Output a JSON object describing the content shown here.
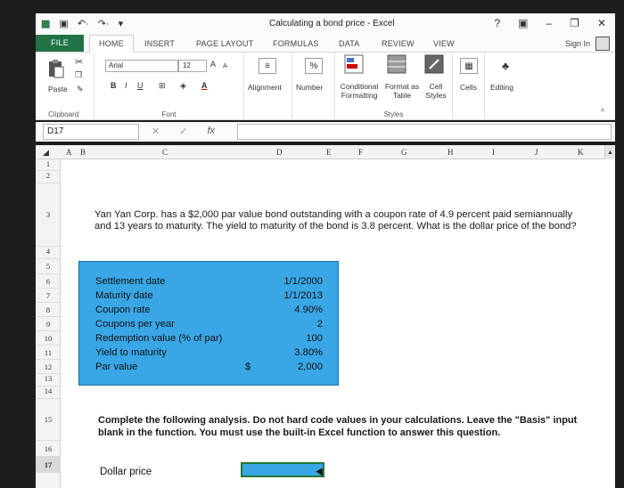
{
  "window": {
    "title": "Calculating a bond price - Excel",
    "help": "?",
    "minimize": "–",
    "close": "✕"
  },
  "tabs": {
    "file": "FILE",
    "items": [
      "HOME",
      "INSERT",
      "PAGE LAYOUT",
      "FORMULAS",
      "DATA",
      "REVIEW",
      "VIEW"
    ],
    "sign_in": "Sign In"
  },
  "ribbon": {
    "paste": "Paste",
    "clipboard": "Clipboard",
    "font_name": "Arial",
    "font_size": "12",
    "font_group": "Font",
    "alignment": "Alignment",
    "number": "Number",
    "conditional_formatting": "Conditional Formatting",
    "format_as_table": "Format as Table",
    "cell_styles": "Cell Styles",
    "styles_group": "Styles",
    "cells": "Cells",
    "editing": "Editing"
  },
  "formula_bar": {
    "name_box": "D17",
    "fx": "fx"
  },
  "sheet": {
    "columns": [
      "A",
      "B",
      "C",
      "D",
      "E",
      "F",
      "G",
      "H",
      "I",
      "J",
      "K"
    ],
    "rows": [
      "1",
      "2",
      "3",
      "4",
      "5",
      "6",
      "7",
      "8",
      "9",
      "10",
      "11",
      "12",
      "13",
      "14",
      "15",
      "16",
      "17"
    ],
    "selected_row": "17",
    "question": "Yan Yan Corp. has a $2,000 par value bond outstanding with a coupon rate of 4.9 percent paid semiannually and 13 years to maturity. The yield to maturity of the bond is 3.8 percent. What is the dollar price of the bond?",
    "inputs": [
      {
        "label": "Settlement date",
        "value": "1/1/2000"
      },
      {
        "label": "Maturity date",
        "value": "1/1/2013"
      },
      {
        "label": "Coupon rate",
        "value": "4.90%"
      },
      {
        "label": "Coupons per year",
        "value": "2"
      },
      {
        "label": "Redemption value (% of par)",
        "value": "100"
      },
      {
        "label": "Yield to maturity",
        "value": "3.80%"
      },
      {
        "label": "Par value",
        "currency": "$",
        "value": "2,000"
      }
    ],
    "instructions": "Complete the following analysis. Do not hard code values in your calculations. Leave the \"Basis\" input blank in the function. You must use the built-in Excel function to answer this question.",
    "answer_label": "Dollar price"
  },
  "colors": {
    "excel_green": "#217346",
    "input_block": "#38a5e4"
  }
}
